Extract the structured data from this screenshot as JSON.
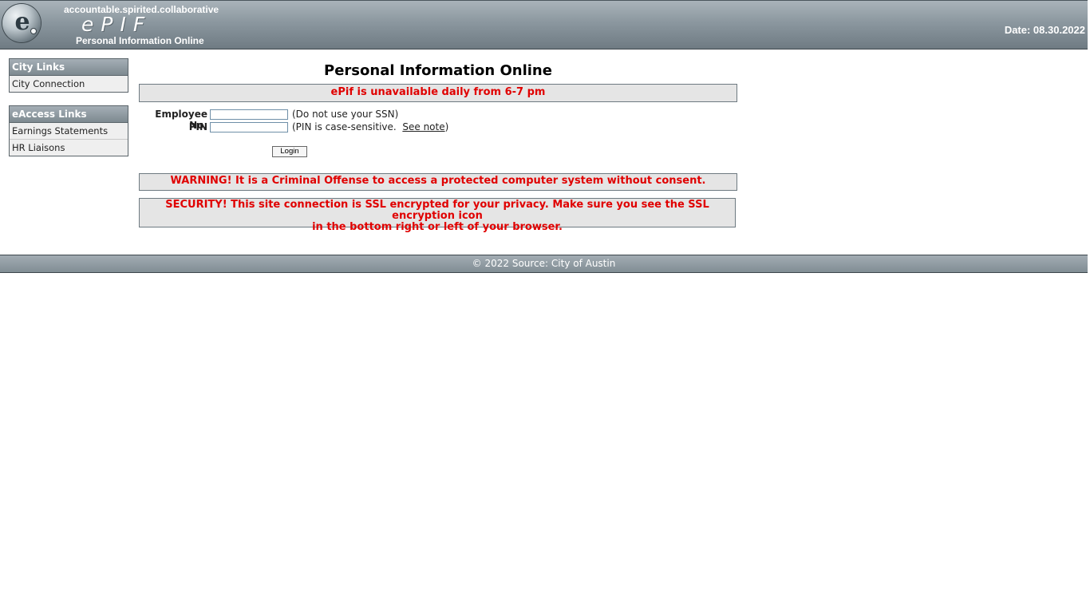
{
  "header": {
    "tagline": "accountable.spirited.collaborative",
    "brand": "ePIF",
    "subtitle": "Personal Information Online",
    "date": "Date: 08.30.2022",
    "logo_icon": "epif-seal-logo"
  },
  "sidebar": {
    "city_links": {
      "title": "City Links",
      "items": [
        {
          "label": "City Connection"
        }
      ]
    },
    "eaccess_links": {
      "title": "eAccess Links",
      "items": [
        {
          "label": "Earnings Statements"
        },
        {
          "label": "HR Liaisons"
        }
      ]
    }
  },
  "main": {
    "title": "Personal Information Online",
    "availability_notice": "ePif is unavailable daily from 6-7 pm",
    "form": {
      "employee_label": "Employee No.",
      "employee_value": "",
      "employee_hint": "(Do not use your SSN)",
      "pin_label": "PIN",
      "pin_value": "",
      "pin_hint_prefix": "(PIN is case-sensitive.",
      "pin_hint_link": "See note",
      "pin_hint_suffix": ")",
      "login_label": "Login"
    },
    "warning": "WARNING! It is a Criminal Offense to access a protected computer system without consent.",
    "security_line1": "SECURITY! This site connection is SSL encrypted for your privacy. Make sure you see the SSL encryption icon",
    "security_line2": "in the bottom right or left of your browser."
  },
  "footer": {
    "text": "© 2022 Source: City of Austin"
  },
  "colors": {
    "alert_red": "#e00000",
    "header_gray": "#8b979f",
    "notice_bg": "#e5e5e5"
  }
}
